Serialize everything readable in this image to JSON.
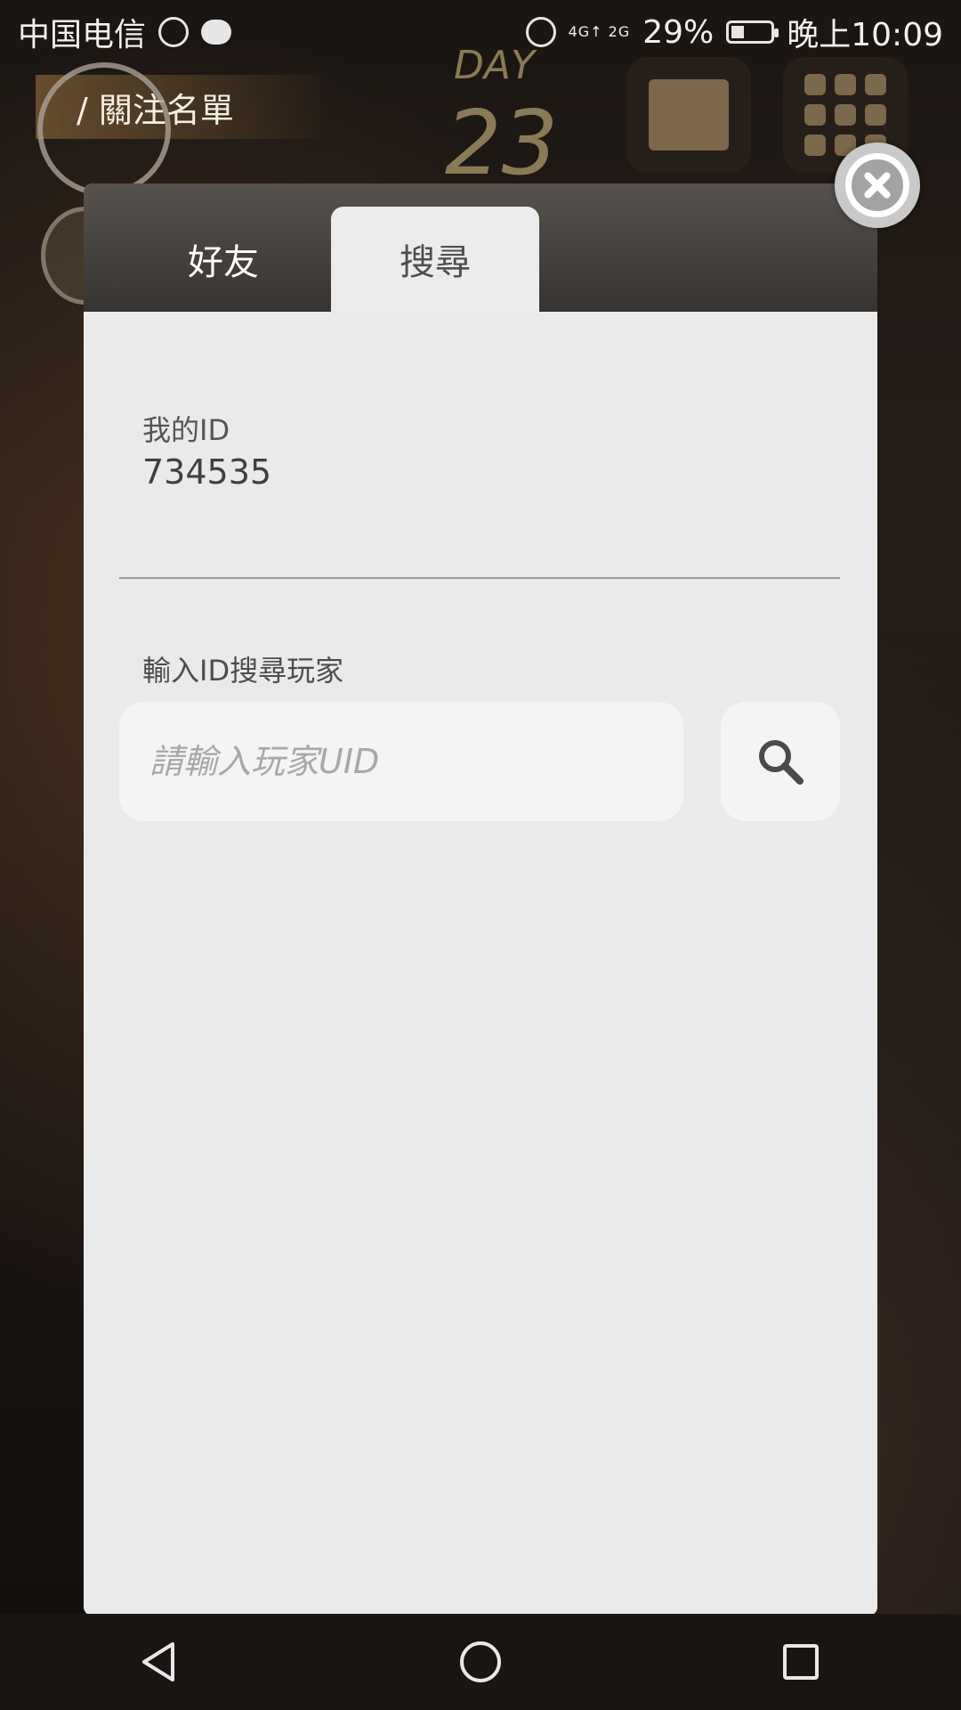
{
  "status_bar": {
    "carrier": "中国电信",
    "signal": "4G↑ 2G",
    "battery": "29%",
    "time": "晚上10:09"
  },
  "hud": {
    "follow_list": "/ 關注名單",
    "day_label": "DAY",
    "day_number": "23"
  },
  "modal": {
    "tabs": [
      {
        "label": "好友",
        "active": false
      },
      {
        "label": "搜尋",
        "active": true
      }
    ],
    "my_id_label": "我的ID",
    "my_id_value": "734535",
    "search_label": "輸入ID搜尋玩家",
    "search_placeholder": "請輸入玩家UID"
  },
  "colors": {
    "modal_bg": "#ececec",
    "tab_bar_bg": "#3a3632",
    "accent_text": "#4e4e4e"
  },
  "icons": {
    "close": "close-icon",
    "search": "search-icon",
    "back": "back-icon",
    "home": "home-icon",
    "recents": "recents-icon"
  }
}
